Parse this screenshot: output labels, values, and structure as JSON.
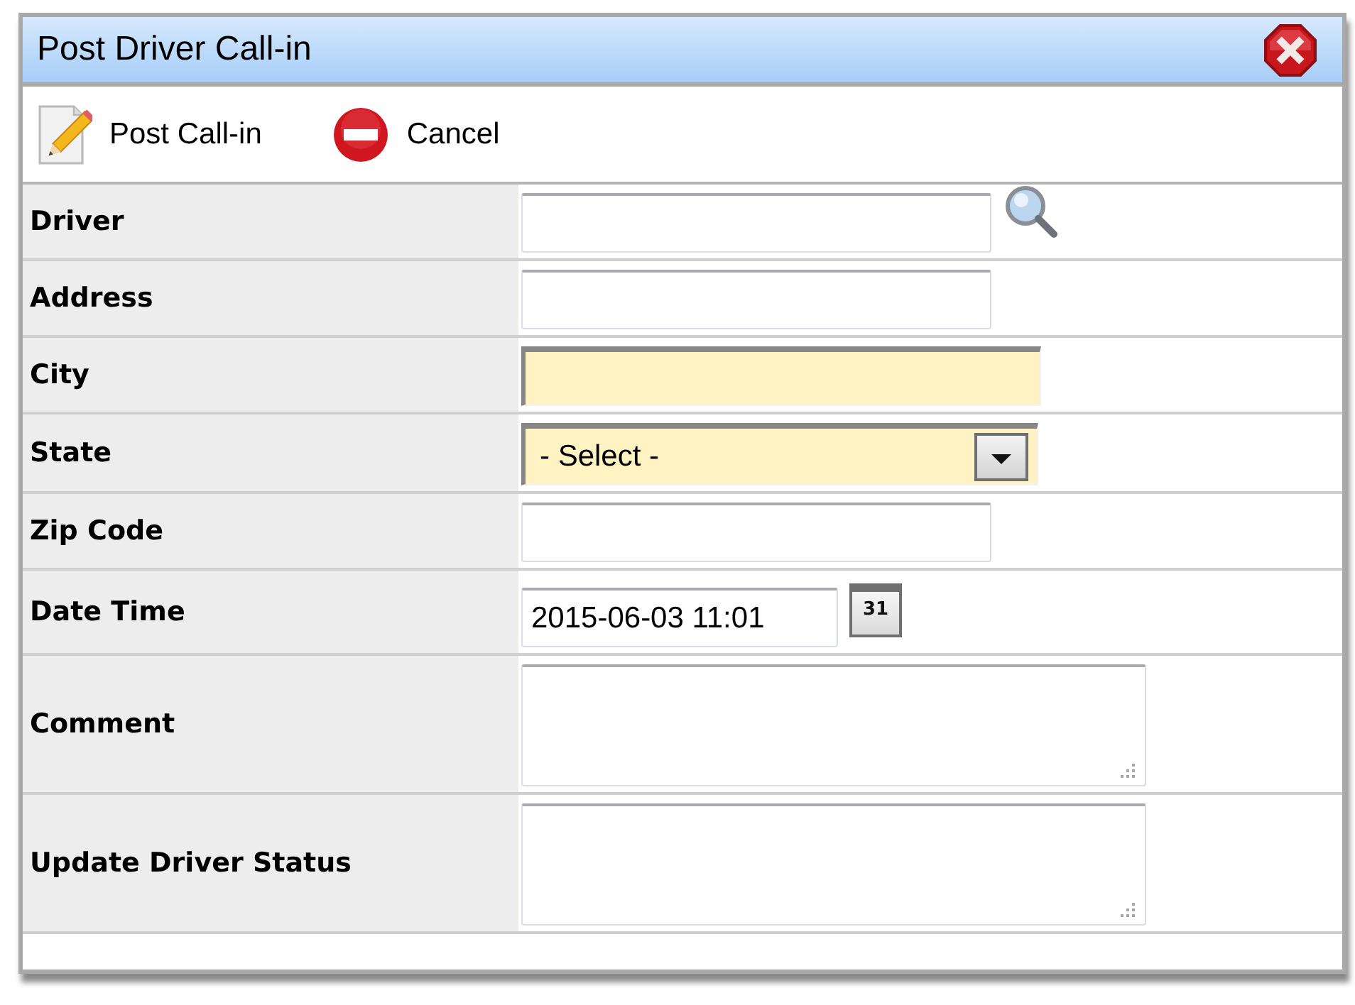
{
  "window": {
    "title": "Post Driver Call-in"
  },
  "toolbar": [
    {
      "kind": "post",
      "label": "Post Call-in"
    },
    {
      "kind": "cancel",
      "label": "Cancel"
    }
  ],
  "fields": [
    {
      "label": "Driver",
      "kind": "lookup",
      "required": false
    },
    {
      "label": "Address",
      "kind": "text",
      "required": false
    },
    {
      "label": "City",
      "kind": "text",
      "required": true
    },
    {
      "label": "State",
      "kind": "select",
      "required": true,
      "value": "- Select -"
    },
    {
      "label": "Zip Code",
      "kind": "text",
      "required": false
    },
    {
      "label": "Date Time",
      "kind": "datetime",
      "required": false,
      "value": "2015-06-03 11:01",
      "picker": "31"
    },
    {
      "label": "Comment",
      "kind": "textarea",
      "required": false
    },
    {
      "label": "Update Driver Status",
      "kind": "textarea",
      "required": false
    }
  ]
}
